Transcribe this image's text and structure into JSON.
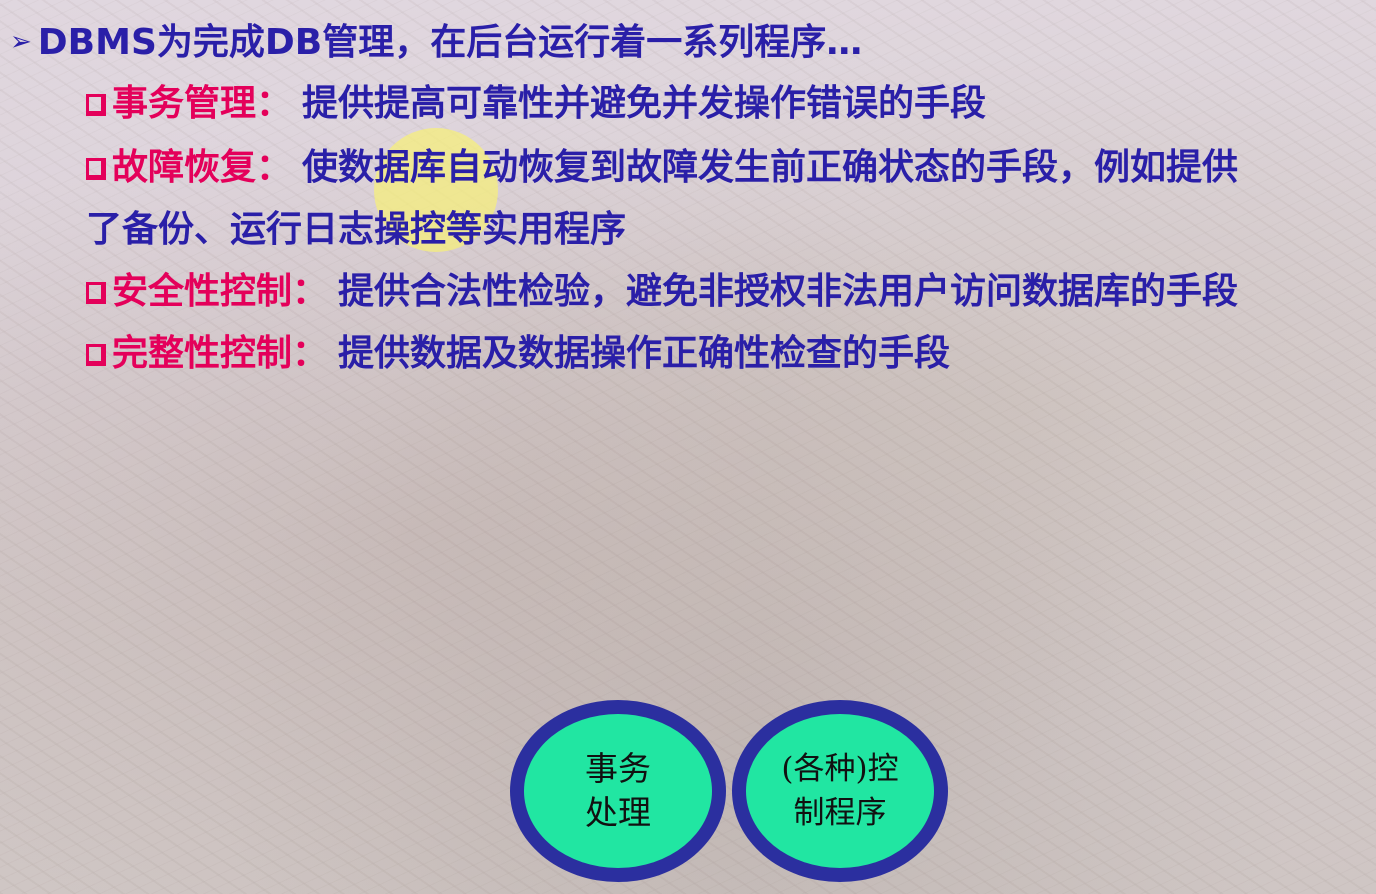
{
  "title": {
    "arrow": "➢",
    "text": "DBMS为完成DB管理，在后台运行着一系列程序…"
  },
  "items": [
    {
      "term": "事务管理",
      "colon": "：",
      "desc": "提供提高可靠性并避免并发操作错误的手段"
    },
    {
      "term": "故障恢复",
      "colon": "：",
      "desc": "使数据库自动恢复到故障发生前正确状态的手段，例如提供",
      "desc_cont": "了备份、运行日志操控等实用程序"
    },
    {
      "term": "安全性控制",
      "colon": "：",
      "desc": "提供合法性检验，避免非授权非法用户访问数据库的手段"
    },
    {
      "term": "完整性控制",
      "colon": "：",
      "desc": "提供数据及数据操作正确性检查的手段"
    }
  ],
  "diagram": {
    "left_circle": "事务\n处理",
    "right_circle": "(各种)控\n制程序",
    "ring_color": "#2b2f9f",
    "fill_color": "#21e6a2"
  },
  "colors": {
    "term": "#e4005a",
    "desc": "#2a1fa8"
  },
  "icons": {
    "bullet_arrow": "arrow-bullet-icon",
    "item_bullet": "hollow-square-bullet-icon"
  }
}
